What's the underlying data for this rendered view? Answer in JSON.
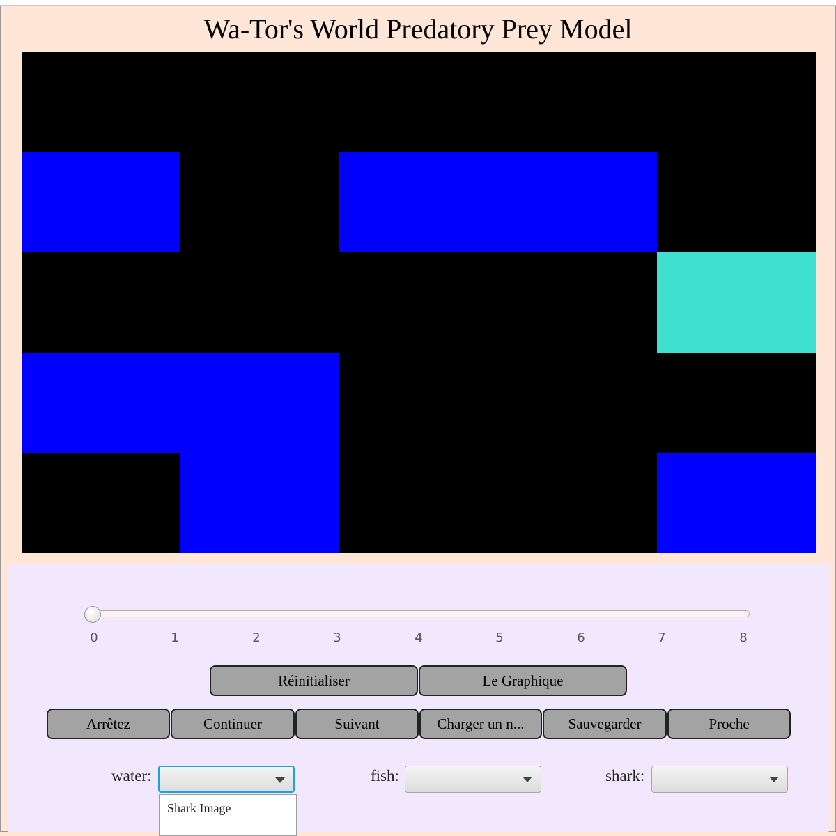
{
  "title": "Wa-Tor's World Predatory Prey Model",
  "colors": {
    "water": "#000000",
    "fish": "#0000ff",
    "shark": "#40e0d0"
  },
  "grid": {
    "rows": [
      [
        "water",
        "water",
        "water",
        "water",
        "water"
      ],
      [
        "fish",
        "water",
        "fish",
        "fish",
        "water"
      ],
      [
        "water",
        "water",
        "water",
        "water",
        "shark"
      ],
      [
        "fish",
        "fish",
        "water",
        "water",
        "water"
      ],
      [
        "water",
        "fish",
        "water",
        "water",
        "fish"
      ]
    ]
  },
  "slider": {
    "value": 0,
    "min": 0,
    "max": 8,
    "ticks": [
      "0",
      "1",
      "2",
      "3",
      "4",
      "5",
      "6",
      "7",
      "8"
    ]
  },
  "buttons": {
    "reset": "Réinitialiser",
    "graph": "Le Graphique",
    "stop": "Arrêtez",
    "continue": "Continuer",
    "next": "Suivant",
    "load": "Charger un n...",
    "save": "Sauvegarder",
    "close": "Proche"
  },
  "selectors": {
    "water_label": "water:",
    "fish_label": "fish:",
    "shark_label": "shark:"
  },
  "dropdown": {
    "items": [
      "Shark Image"
    ]
  }
}
